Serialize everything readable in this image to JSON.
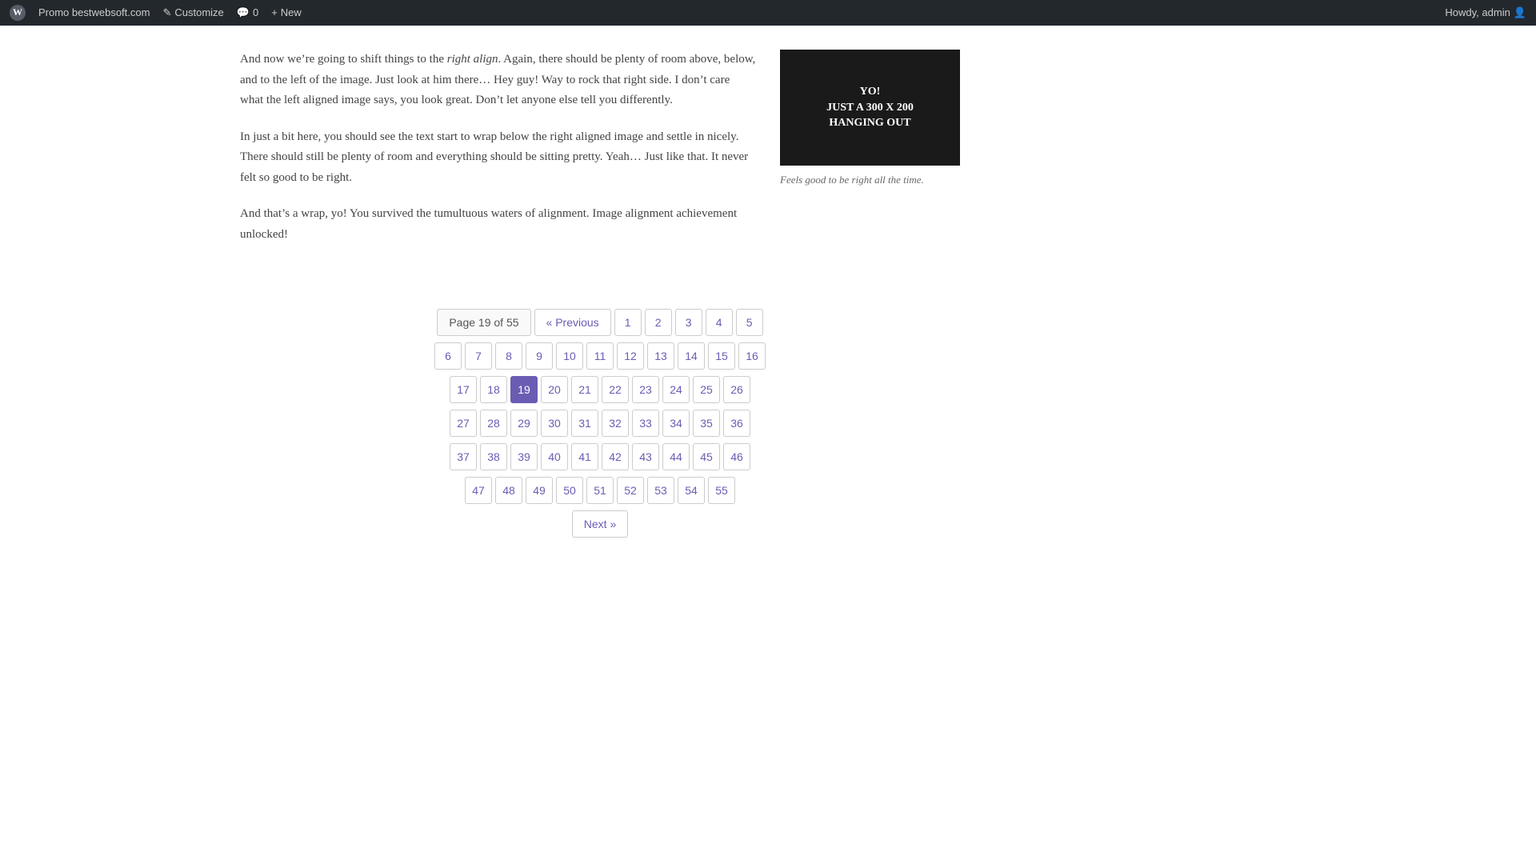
{
  "adminBar": {
    "logo": "W",
    "siteLink": "Promo bestwebsoft.com",
    "customize": "Customize",
    "comments": "0",
    "new": "New",
    "howdy": "Howdy, admin"
  },
  "article": {
    "paragraphs": {
      "p1": "And now we’re going to shift things to the right align. Again, there should be plenty of room above, below, and to the left of the image. Just look at him there… Hey guy! Way to rock that right side. I don’t care what the left aligned image says, you look great. Don’t let anyone else tell you differently.",
      "p1_italic": "right align",
      "p2": "In just a bit here, you should see the text start to wrap below the right aligned image and settle in nicely. There should still be plenty of room and everything should be sitting pretty. Yeah… Just like that. It never felt so good to be right.",
      "p3": "And that’s a wrap, yo! You survived the tumultuous waters of alignment. Image alignment achievement unlocked!"
    },
    "figure": {
      "imageText1": "YO!",
      "imageText2": "JUST A 300 X 200",
      "imageText3": "HANGING OUT",
      "caption": "Feels good to be right all the time."
    }
  },
  "pagination": {
    "pageLabel": "Page 19 of 55",
    "previous": "« Previous",
    "next": "Next »",
    "currentPage": 19,
    "rows": [
      [
        "prev",
        1,
        2,
        3,
        4,
        5
      ],
      [
        6,
        7,
        8,
        9,
        10,
        11,
        12,
        13,
        14,
        15,
        16
      ],
      [
        17,
        18,
        19,
        20,
        21,
        22,
        23,
        24,
        25,
        26
      ],
      [
        27,
        28,
        29,
        30,
        31,
        32,
        33,
        34,
        35,
        36
      ],
      [
        37,
        38,
        39,
        40,
        41,
        42,
        43,
        44,
        45,
        46
      ],
      [
        47,
        48,
        49,
        50,
        51,
        52,
        53,
        54,
        55
      ],
      [
        "next"
      ]
    ]
  }
}
